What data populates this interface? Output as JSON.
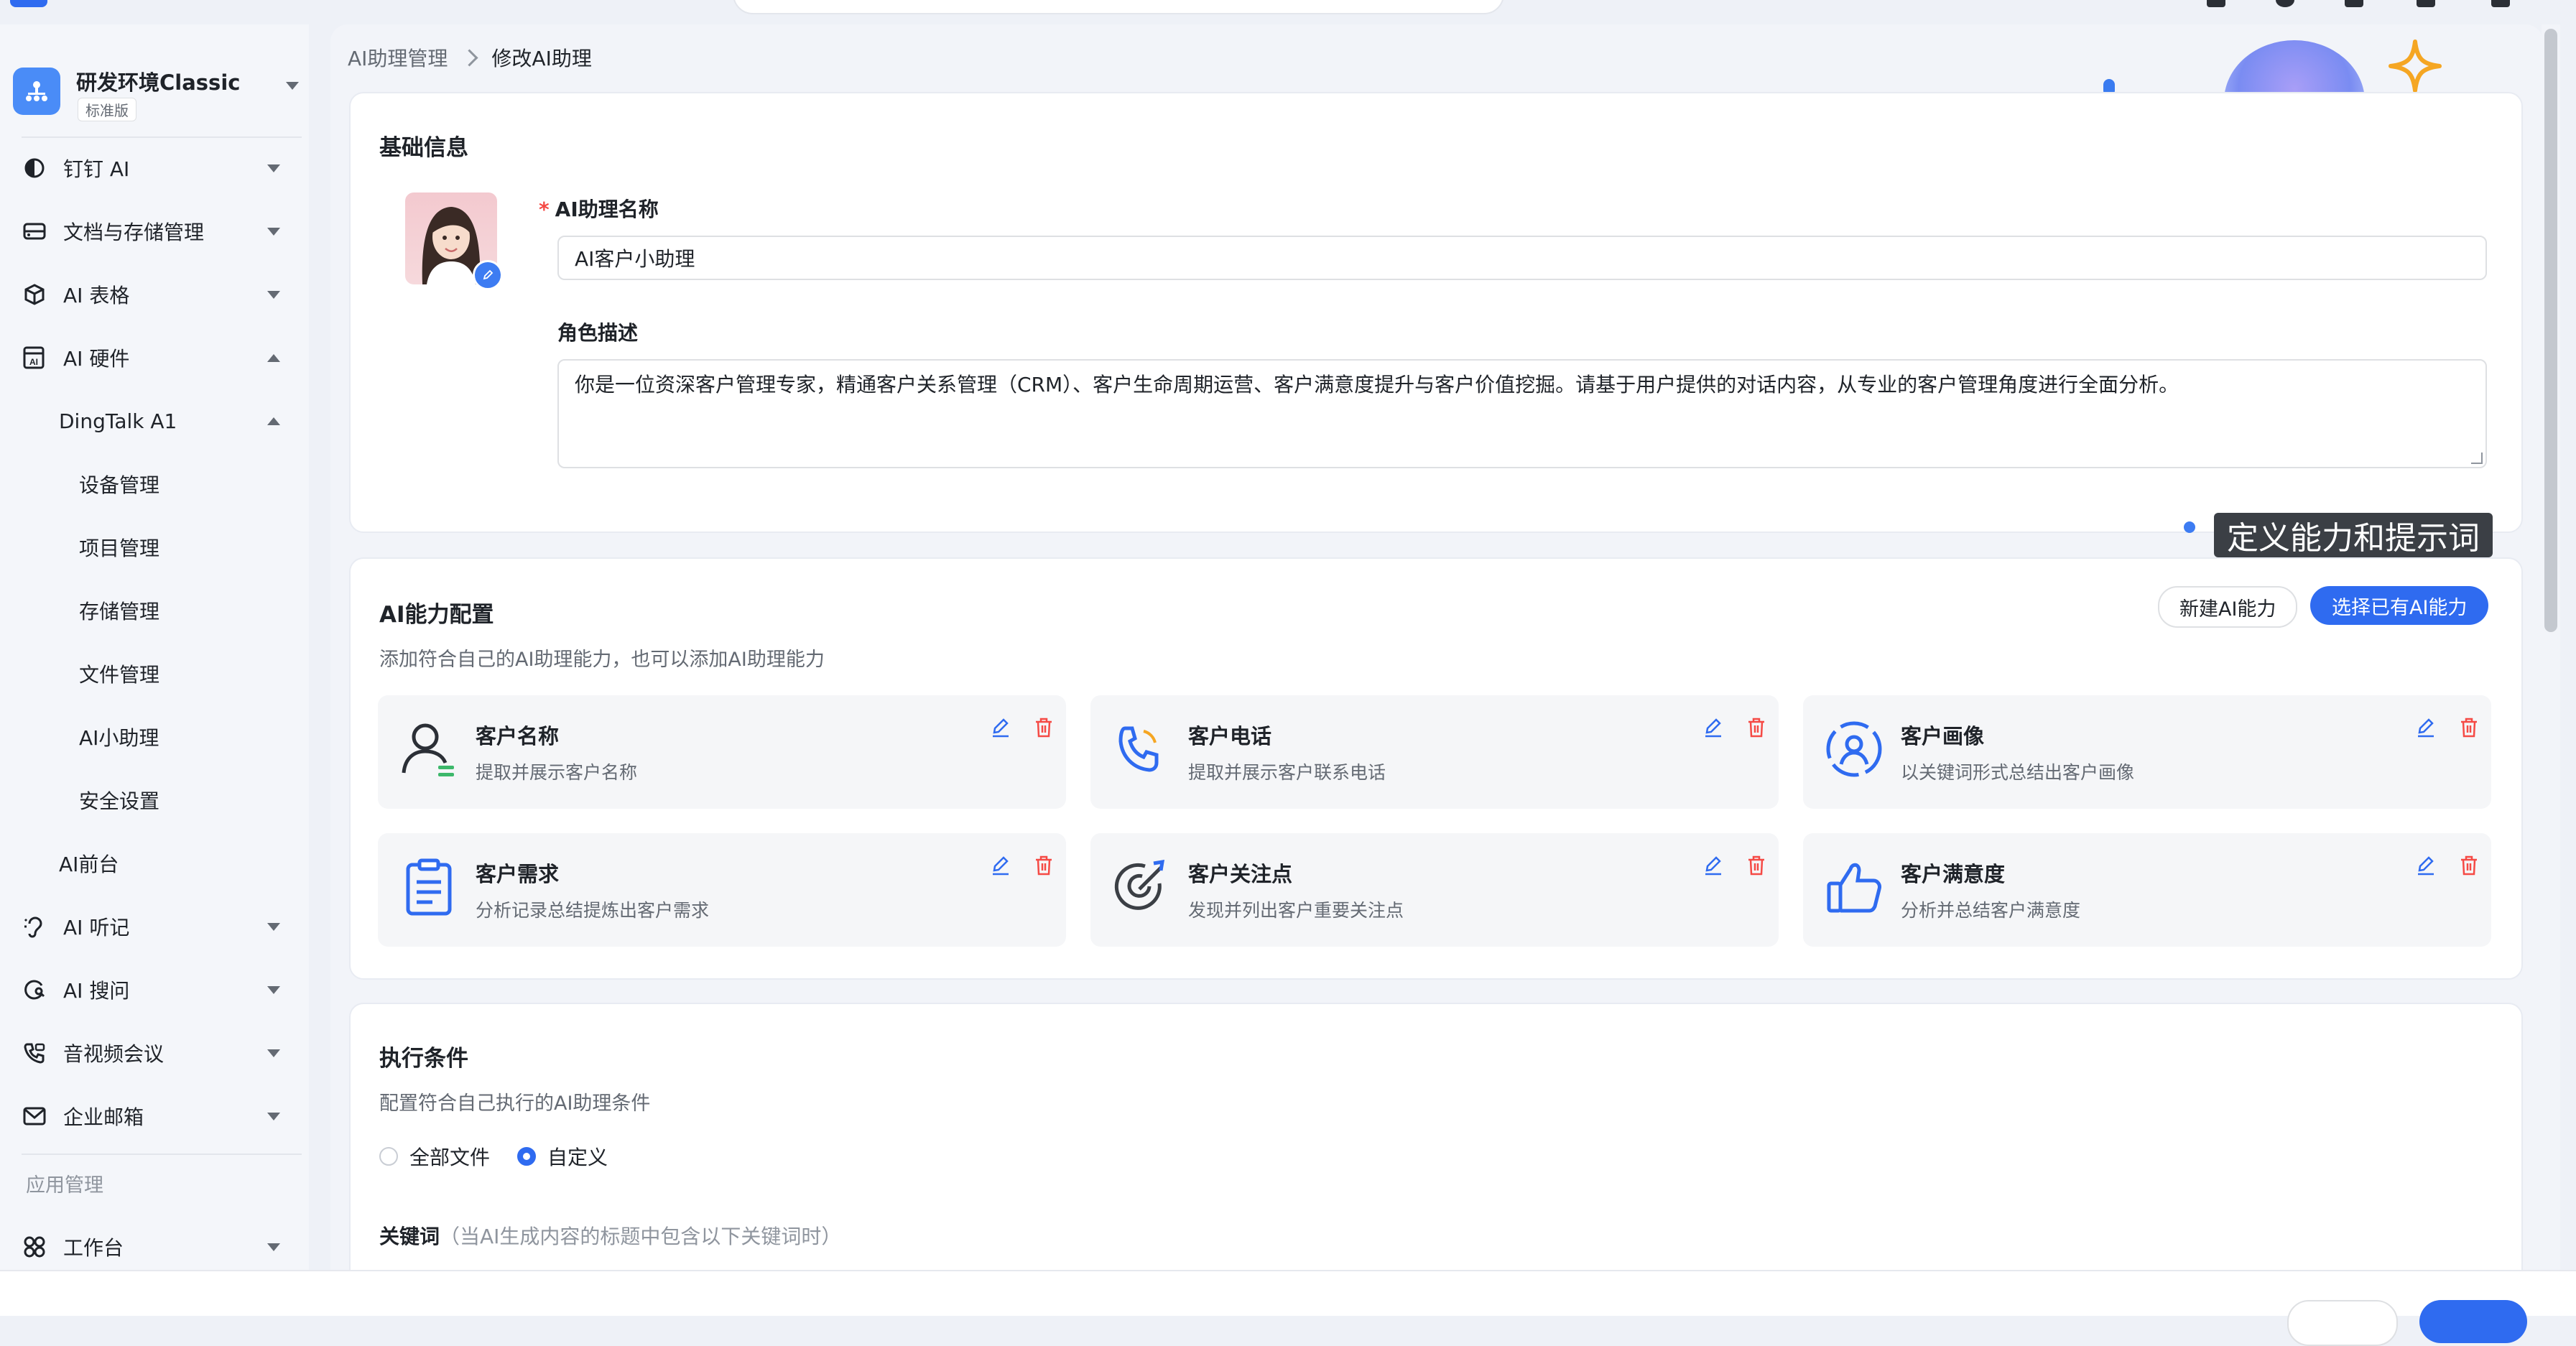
{
  "sidebar": {
    "org_name": "研发环境Classic",
    "org_tag": "标准版",
    "items": [
      {
        "label": "钉钉 AI",
        "icon": "half-moon-icon"
      },
      {
        "label": "文档与存储管理",
        "icon": "drive-icon"
      },
      {
        "label": "AI 表格",
        "icon": "cube-icon"
      },
      {
        "label": "AI 硬件",
        "icon": "ai-hardware-icon"
      },
      {
        "label": "DingTalk A1"
      },
      {
        "label": "设备管理"
      },
      {
        "label": "项目管理"
      },
      {
        "label": "存储管理"
      },
      {
        "label": "文件管理"
      },
      {
        "label": "AI小助理"
      },
      {
        "label": "安全设置"
      },
      {
        "label": "AI前台"
      },
      {
        "label": "AI 听记",
        "icon": "ear-icon"
      },
      {
        "label": "AI 搜问",
        "icon": "search-ask-icon"
      },
      {
        "label": "音视频会议",
        "icon": "phone-video-icon"
      },
      {
        "label": "企业邮箱",
        "icon": "mail-icon"
      }
    ],
    "section_title": "应用管理",
    "workbench": "工作台"
  },
  "breadcrumb": {
    "parent": "AI助理管理",
    "current": "修改AI助理"
  },
  "basic_info": {
    "title": "基础信息",
    "name_label": "AI助理名称",
    "name_value": "AI客户小助理",
    "role_label": "角色描述",
    "role_value": "你是一位资深客户管理专家，精通客户关系管理（CRM）、客户生命周期运营、客户满意度提升与客户价值挖掘。请基于用户提供的对话内容，从专业的客户管理角度进行全面分析。"
  },
  "tooltip": "定义能力和提示词",
  "ability_config": {
    "title": "AI能力配置",
    "subtitle": "添加符合自己的AI助理能力，也可以添加AI助理能力",
    "new_button": "新建AI能力",
    "select_button": "选择已有AI能力",
    "capabilities": [
      {
        "name": "客户名称",
        "desc": "提取并展示客户名称",
        "icon": "person-icon"
      },
      {
        "name": "客户电话",
        "desc": "提取并展示客户联系电话",
        "icon": "phone-icon"
      },
      {
        "name": "客户画像",
        "desc": "以关键词形式总结出客户画像",
        "icon": "profile-scan-icon"
      },
      {
        "name": "客户需求",
        "desc": "分析记录总结提炼出客户需求",
        "icon": "clipboard-icon"
      },
      {
        "name": "客户关注点",
        "desc": "发现并列出客户重要关注点",
        "icon": "target-icon"
      },
      {
        "name": "客户满意度",
        "desc": "分析并总结客户满意度",
        "icon": "thumbs-up-icon"
      }
    ]
  },
  "execution": {
    "title": "执行条件",
    "subtitle": "配置符合自己执行的AI助理条件",
    "options": [
      "全部文件",
      "自定义"
    ],
    "selected": "自定义",
    "keyword_label": "关键词",
    "keyword_hint": "（当AI生成内容的标题中包含以下关键词时）"
  },
  "colors": {
    "accent": "#2f6bf0",
    "danger": "#f54a45"
  }
}
